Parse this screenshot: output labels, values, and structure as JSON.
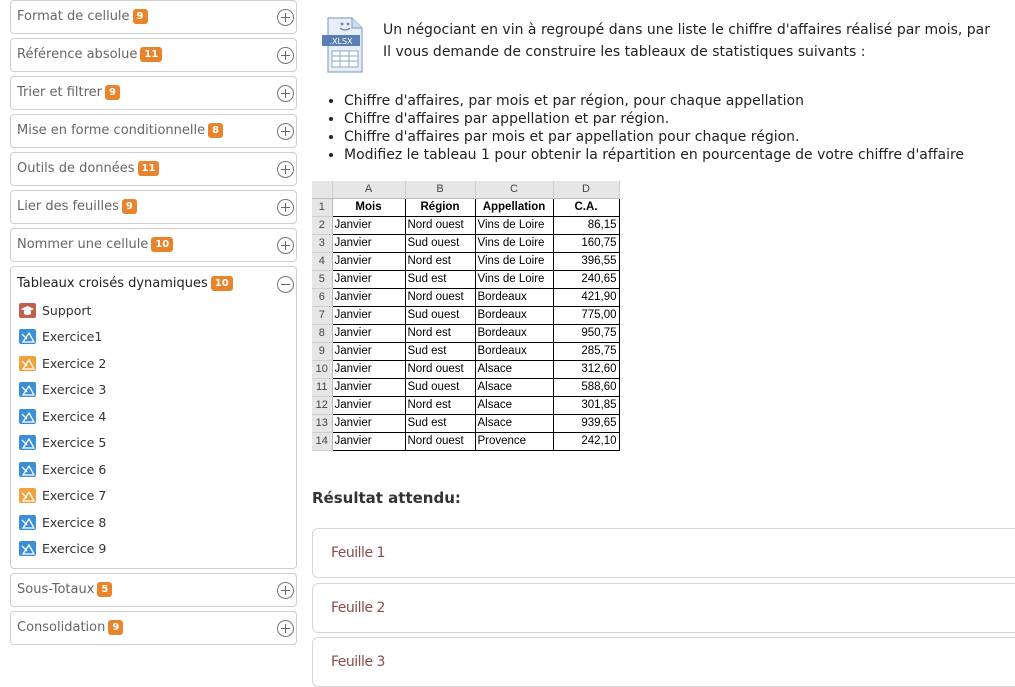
{
  "sidebar": {
    "sections": [
      {
        "title": "Format de cellule",
        "count": "9"
      },
      {
        "title": "Référence absolue",
        "count": "11"
      },
      {
        "title": "Trier et filtrer",
        "count": "9"
      },
      {
        "title": "Mise en forme conditionnelle",
        "count": "8"
      },
      {
        "title": "Outils de données",
        "count": "11"
      },
      {
        "title": "Lier des feuilles",
        "count": "9"
      },
      {
        "title": "Nommer une cellule",
        "count": "10"
      }
    ],
    "open_section": {
      "title": "Tableaux croisés dynamiques",
      "count": "10",
      "items": [
        {
          "label": "Support",
          "icon": "graduation-cap-icon",
          "color": "#c0604e"
        },
        {
          "label": "Exercice1",
          "icon": "exercise-icon",
          "color": "#3a8fd6"
        },
        {
          "label": "Exercice 2",
          "icon": "exercise-icon",
          "color": "#f0a23c"
        },
        {
          "label": "Exercice 3",
          "icon": "exercise-icon",
          "color": "#3a8fd6"
        },
        {
          "label": "Exercice 4",
          "icon": "exercise-icon",
          "color": "#3a8fd6"
        },
        {
          "label": "Exercice 5",
          "icon": "exercise-icon",
          "color": "#3a8fd6"
        },
        {
          "label": "Exercice 6",
          "icon": "exercise-icon",
          "color": "#3a8fd6"
        },
        {
          "label": "Exercice 7",
          "icon": "exercise-icon",
          "color": "#f0a23c"
        },
        {
          "label": "Exercice 8",
          "icon": "exercise-icon",
          "color": "#3a8fd6"
        },
        {
          "label": "Exercice 9",
          "icon": "exercise-icon",
          "color": "#3a8fd6"
        }
      ]
    },
    "after_sections": [
      {
        "title": "Sous-Totaux",
        "count": "5"
      },
      {
        "title": "Consolidation",
        "count": "9"
      }
    ]
  },
  "main": {
    "file_icon_label": ".XLSX",
    "intro_line1": "Un négociant en vin à regroupé dans une liste le chiffre d'affaires réalisé par mois, par",
    "intro_line2": "Il vous demande de construire les tableaux de statistiques suivants :",
    "bullets": [
      "Chiffre d'affaires, par mois et par région, pour chaque appellation",
      "Chiffre d'affaires par appellation et par région.",
      "Chiffre d'affaires par mois et par appellation pour chaque région.",
      "Modifiez le tableau 1 pour obtenir la répartition en pourcentage de votre chiffre d'affaire"
    ],
    "spreadsheet": {
      "columns": [
        "A",
        "B",
        "C",
        "D"
      ],
      "headers": [
        "Mois",
        "Région",
        "Appellation",
        "C.A."
      ],
      "rows": [
        [
          "2",
          "Janvier",
          "Nord ouest",
          "Vins de Loire",
          "86,15"
        ],
        [
          "3",
          "Janvier",
          "Sud ouest",
          "Vins de Loire",
          "160,75"
        ],
        [
          "4",
          "Janvier",
          "Nord est",
          "Vins de Loire",
          "396,55"
        ],
        [
          "5",
          "Janvier",
          "Sud est",
          "Vins de Loire",
          "240,65"
        ],
        [
          "6",
          "Janvier",
          "Nord ouest",
          "Bordeaux",
          "421,90"
        ],
        [
          "7",
          "Janvier",
          "Sud ouest",
          "Bordeaux",
          "775,00"
        ],
        [
          "8",
          "Janvier",
          "Nord est",
          "Bordeaux",
          "950,75"
        ],
        [
          "9",
          "Janvier",
          "Sud est",
          "Bordeaux",
          "285,75"
        ],
        [
          "10",
          "Janvier",
          "Nord ouest",
          "Alsace",
          "312,60"
        ],
        [
          "11",
          "Janvier",
          "Sud ouest",
          "Alsace",
          "588,60"
        ],
        [
          "12",
          "Janvier",
          "Nord est",
          "Alsace",
          "301,85"
        ],
        [
          "13",
          "Janvier",
          "Sud est",
          "Alsace",
          "939,65"
        ],
        [
          "14",
          "Janvier",
          "Nord ouest",
          "Provence",
          "242,10"
        ]
      ]
    },
    "result_title": "Résultat attendu:",
    "sheets": [
      "Feuille 1",
      "Feuille 2",
      "Feuille 3"
    ]
  }
}
